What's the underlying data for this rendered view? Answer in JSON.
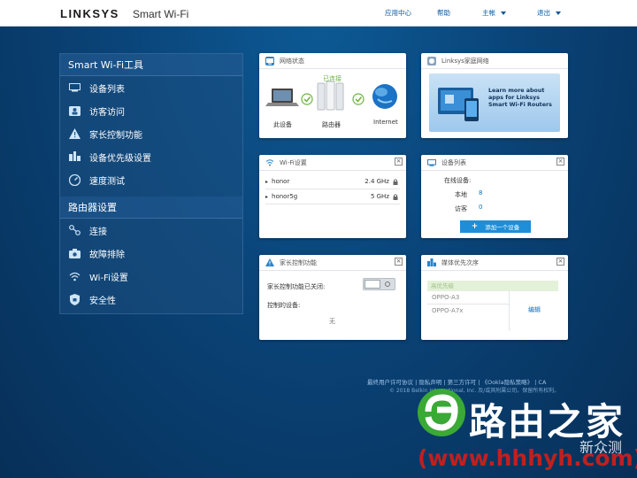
{
  "header": {
    "brand": "LINKSYS",
    "product": "Smart Wi-Fi",
    "nav": [
      "应用中心",
      "帮助",
      "主帐",
      "退出"
    ]
  },
  "sidebar": {
    "section1_title": "Smart Wi-Fi工具",
    "tools": [
      {
        "label": "设备列表",
        "icon": "device-list-icon"
      },
      {
        "label": "访客访问",
        "icon": "guest-access-icon"
      },
      {
        "label": "家长控制功能",
        "icon": "parental-control-icon"
      },
      {
        "label": "设备优先级设置",
        "icon": "device-priority-icon"
      },
      {
        "label": "速度测试",
        "icon": "speed-test-icon"
      }
    ],
    "section2_title": "路由器设置",
    "settings": [
      {
        "label": "连接",
        "icon": "connectivity-icon"
      },
      {
        "label": "故障排除",
        "icon": "troubleshooting-icon"
      },
      {
        "label": "Wi-Fi设置",
        "icon": "wifi-icon"
      },
      {
        "label": "安全性",
        "icon": "security-icon"
      }
    ]
  },
  "network_status": {
    "title": "网络状态",
    "connected_label": "已连接",
    "this_device": "此设备",
    "router": "路由器",
    "internet": "Internet"
  },
  "linksys_home": {
    "title": "Linksys家庭网络",
    "promo": "Learn more about apps for Linksys Smart Wi-Fi Routers"
  },
  "wifi_settings": {
    "title": "Wi-Fi设置",
    "networks": [
      {
        "name": "honor",
        "band": "2.4 GHz"
      },
      {
        "name": "honor5g",
        "band": "5 GHz"
      }
    ]
  },
  "device_list": {
    "title": "设备列表",
    "online_label": "在线设备:",
    "rows": [
      {
        "label": "本地",
        "value": "8"
      },
      {
        "label": "访客",
        "value": "0"
      }
    ],
    "add_button": "添加一个设备"
  },
  "parental": {
    "title": "家长控制功能",
    "status": "家长控制功能已关闭:",
    "controlled_label": "控制的设备:",
    "none": "无"
  },
  "media_priority": {
    "title": "媒体优先次序",
    "header": "高优先级",
    "devices": [
      "OPPO-A3",
      "OPPO-A7x"
    ],
    "edit": "编辑"
  },
  "footer": {
    "links": "最终用户许可协议 | 隐私声明 | 第三方许可 | 《Ookla隐私策略》 | CA",
    "copyright": "© 2018 Belkin International, Inc. 及/或其附属公司。保留所有权利。"
  },
  "watermark": {
    "name": "路由之家",
    "url": "(www.hhhyh.com)",
    "badge": "新众测"
  },
  "colors": {
    "accent": "#0a70c0",
    "check": "#6db33f",
    "button": "#1e8ed8"
  }
}
